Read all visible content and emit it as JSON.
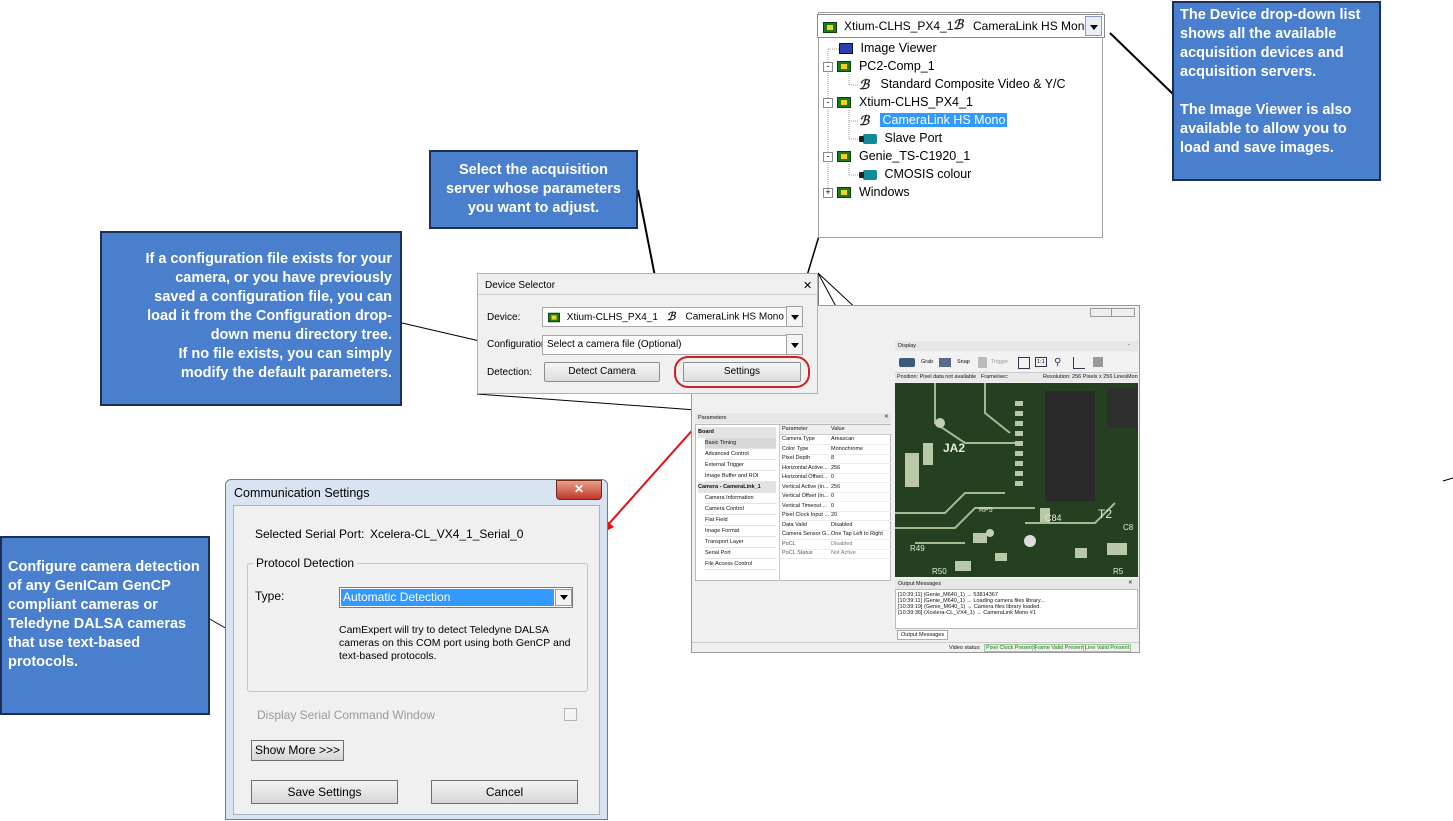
{
  "callouts": {
    "device_dropdown": "The Device drop-down list shows all the available acquisition devices and acquisition servers.",
    "image_viewer": "The Image Viewer is also available to allow you to load and save images.",
    "select_server": "Select the acquisition server whose parameters you want to adjust.",
    "config_file_lines": [
      "If a configuration file exists for your",
      "camera, or you have previously",
      "saved a configuration file, you can",
      "load it from the Configuration drop-",
      "down menu directory tree.",
      "If no file exists, you can simply",
      "modify the default parameters."
    ],
    "configure_detection": "Configure camera detection of any GenICam GenCP compliant cameras or Teledyne DALSA cameras that use text-based protocols."
  },
  "device_tree": {
    "selected_device": "Xtium-CLHS_PX4_1",
    "selected_server": "CameraLink HS Mono",
    "items": [
      {
        "label": "Image Viewer",
        "icon": "monitor-icon"
      },
      {
        "label": "PC2-Comp_1",
        "icon": "board-icon"
      },
      {
        "label": "Standard Composite Video & Y/C",
        "icon": "cable-icon"
      },
      {
        "label": "Xtium-CLHS_PX4_1",
        "icon": "board-icon"
      },
      {
        "label": "CameraLink HS Mono",
        "icon": "cable-icon",
        "selected": true
      },
      {
        "label": "Slave Port",
        "icon": "camera-icon"
      },
      {
        "label": "Genie_TS-C1920_1",
        "icon": "board-icon"
      },
      {
        "label": "CMOSIS colour",
        "icon": "camera-icon"
      },
      {
        "label": "Windows",
        "icon": "board-icon"
      }
    ],
    "expanders": [
      "-",
      "-",
      "-",
      "+"
    ]
  },
  "device_selector": {
    "title": "Device Selector",
    "close": "✕",
    "device_label": "Device:",
    "device_value": "Xtium-CLHS_PX4_1",
    "server_value": "CameraLink HS Mono",
    "configuration_label": "Configuration:",
    "configuration_value": "Select a camera file (Optional)",
    "detection_label": "Detection:",
    "detect_button": "Detect Camera",
    "settings_button": "Settings"
  },
  "camexpert": {
    "display_title": "Display",
    "toolbar": [
      "Grab",
      "Snap",
      "Trigger"
    ],
    "zoom_label": "1:1",
    "status_position": "Position: Pixel data not available",
    "status_frame": "Frame/sec:",
    "status_resolution": "Resolution: 256 Pixels x 256 Lines",
    "status_mon": "Mon",
    "board_labels": [
      "JA2",
      "RP5",
      "C84",
      "T2",
      "R49",
      "R50",
      "C8",
      "R5"
    ],
    "parameters_title": "Parameters",
    "categories": [
      {
        "label": "Board",
        "header": true
      },
      {
        "label": "Basic Timing",
        "selected": true
      },
      {
        "label": "Advanced Control"
      },
      {
        "label": "External Trigger"
      },
      {
        "label": "Image Buffer and ROI"
      },
      {
        "label": "Camera - CameraLink_1",
        "header": true
      },
      {
        "label": "Camera Information"
      },
      {
        "label": "Camera Control"
      },
      {
        "label": "Flat Field"
      },
      {
        "label": "Image Format"
      },
      {
        "label": "Transport Layer"
      },
      {
        "label": "Serial Port"
      },
      {
        "label": "File Access Control"
      }
    ],
    "param_header": [
      "Parameter",
      "Value"
    ],
    "params": [
      [
        "Camera Type",
        "Areascan"
      ],
      [
        "Color Type",
        "Monochrome"
      ],
      [
        "Pixel Depth",
        "8"
      ],
      [
        "Horizontal Active...",
        "256"
      ],
      [
        "Horizontal Offset...",
        "0"
      ],
      [
        "Vertical Active (in...",
        "256"
      ],
      [
        "Vertical Offset (in...",
        "0"
      ],
      [
        "Vertical Timeout ...",
        "0"
      ],
      [
        "Pixel Clock Input ...",
        "20"
      ],
      [
        "Data Valid",
        "Disabled"
      ],
      [
        "Camera Sensor G...",
        "One Tap Left to Right"
      ],
      [
        "PoCL",
        "Disabled"
      ],
      [
        "PoCL Status",
        "Not Active"
      ]
    ],
    "output_title": "Output Messages",
    "output_lines": [
      "[10:39:11] (Genie_M640_1) → 53814367",
      "[10:39:11] (Genie_M640_1) → Loading camera files library...",
      "[10:39:19] (Genie_M640_1) → Camera files library loaded.",
      "[10:39:36] (Xcelera-CL_VX4_1) → CameraLink Mono #1"
    ],
    "output_tab": "Output Messages",
    "video_status_label": "Video status:",
    "video_status": [
      "Pixel Clock Present",
      "Frame Valid Present",
      "Line Valid Present"
    ]
  },
  "comm_settings": {
    "title": "Communication Settings",
    "close": "✕",
    "serial_port_label": "Selected Serial Port:",
    "serial_port_value": "Xcelera-CL_VX4_1_Serial_0",
    "group_title": "Protocol Detection",
    "type_label": "Type:",
    "type_value": "Automatic Detection",
    "description_lines": [
      "CamExpert will try to detect Teledyne DALSA",
      "cameras on this COM port using both GenCP and",
      "text-based protocols."
    ],
    "display_serial": "Display Serial Command Window",
    "show_more": "Show More >>>",
    "save": "Save Settings",
    "cancel": "Cancel"
  }
}
